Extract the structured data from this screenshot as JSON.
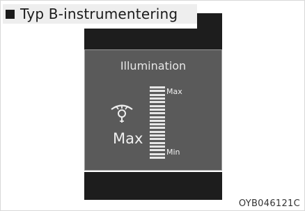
{
  "header": {
    "title": "Typ B-instrumentering"
  },
  "display": {
    "title": "Illumination",
    "level_label": "Max",
    "scale_max_label": "Max",
    "scale_min_label": "Min",
    "level_fraction": 1.0,
    "scale_segments": 20
  },
  "icons": {
    "illumination": "illumination-icon"
  },
  "footer": {
    "code": "OYB046121C"
  }
}
